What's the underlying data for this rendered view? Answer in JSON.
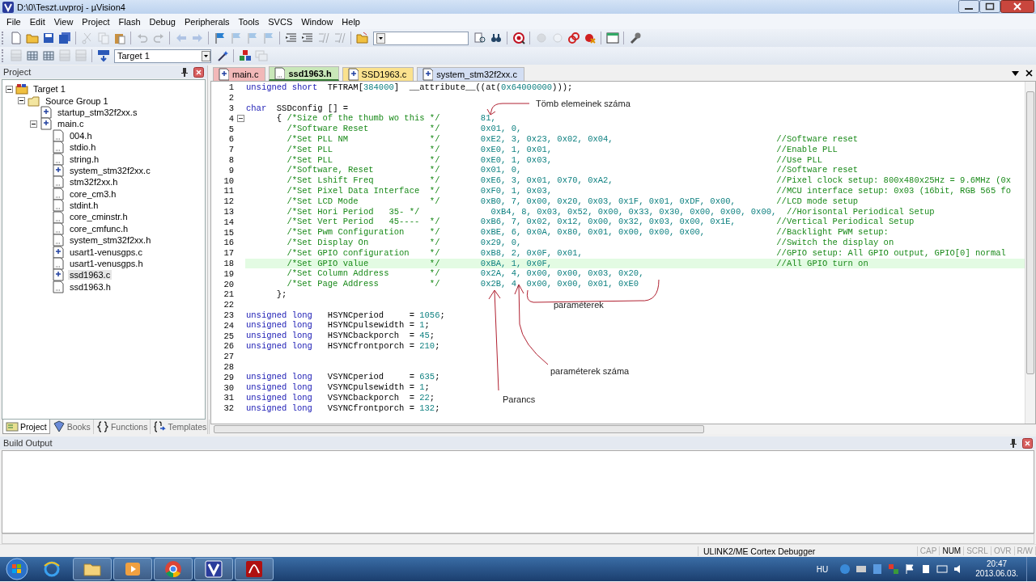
{
  "window": {
    "title": "D:\\0\\Teszt.uvproj - µVision4"
  },
  "menu": [
    "File",
    "Edit",
    "View",
    "Project",
    "Flash",
    "Debug",
    "Peripherals",
    "Tools",
    "SVCS",
    "Window",
    "Help"
  ],
  "toolbar_1": [
    {
      "disabled": false
    },
    {
      "disabled": false
    },
    {
      "disabled": false
    },
    {
      "disabled": false
    },
    {
      "disabled": true
    },
    {
      "disabled": true
    },
    {
      "disabled": false
    },
    {
      "disabled": true
    },
    {
      "disabled": true
    },
    {
      "disabled": true
    },
    {
      "disabled": true
    },
    {
      "disabled": false
    },
    {
      "disabled": true
    },
    {
      "disabled": true
    },
    {
      "disabled": true
    },
    {
      "disabled": false
    },
    {
      "disabled": false
    },
    {
      "disabled": true
    },
    {
      "disabled": true
    },
    {
      "disabled": false
    },
    {
      "disabled": false
    },
    {
      "disabled": false
    },
    {
      "disabled": false
    },
    {
      "disabled": true
    },
    {
      "disabled": true
    },
    {
      "disabled": false
    },
    {
      "disabled": false
    },
    {
      "disabled": false
    },
    {
      "disabled": false
    }
  ],
  "toolbar_2": {
    "buttons": [
      {
        "disabled": true
      },
      {
        "disabled": false
      },
      {
        "disabled": false
      },
      {
        "disabled": true
      },
      {
        "disabled": true
      },
      {
        "disabled": false
      }
    ],
    "target": "Target 1",
    "tools": [
      {
        "disabled": false
      },
      {
        "disabled": false
      },
      {
        "disabled": true
      }
    ]
  },
  "project_panel": {
    "title": "Project",
    "tree": [
      {
        "label": "Target 1",
        "kind": "target",
        "expanded": true,
        "selected": false,
        "children": [
          {
            "label": "Source Group 1",
            "kind": "group",
            "expanded": true,
            "selected": false,
            "children": [
              {
                "label": "startup_stm32f2xx.s",
                "kind": "source",
                "selected": false
              },
              {
                "label": "main.c",
                "kind": "source",
                "expanded": true,
                "selected": false,
                "children": [
                  {
                    "label": "004.h",
                    "kind": "header",
                    "selected": false
                  },
                  {
                    "label": "stdio.h",
                    "kind": "header",
                    "selected": false
                  },
                  {
                    "label": "string.h",
                    "kind": "header",
                    "selected": false
                  },
                  {
                    "label": "system_stm32f2xx.c",
                    "kind": "source",
                    "selected": false
                  },
                  {
                    "label": "stm32f2xx.h",
                    "kind": "header",
                    "selected": false
                  },
                  {
                    "label": "core_cm3.h",
                    "kind": "header",
                    "selected": false
                  },
                  {
                    "label": "stdint.h",
                    "kind": "header",
                    "selected": false
                  },
                  {
                    "label": "core_cminstr.h",
                    "kind": "header",
                    "selected": false
                  },
                  {
                    "label": "core_cmfunc.h",
                    "kind": "header",
                    "selected": false
                  },
                  {
                    "label": "system_stm32f2xx.h",
                    "kind": "header",
                    "selected": false
                  },
                  {
                    "label": "usart1-venusgps.c",
                    "kind": "source",
                    "selected": false
                  },
                  {
                    "label": "usart1-venusgps.h",
                    "kind": "header",
                    "selected": false
                  },
                  {
                    "label": "ssd1963.c",
                    "kind": "source",
                    "selected": true
                  },
                  {
                    "label": "ssd1963.h",
                    "kind": "header",
                    "selected": false
                  }
                ]
              }
            ]
          }
        ]
      }
    ],
    "tabs": [
      {
        "label": "Project",
        "selected": true
      },
      {
        "label": "Books",
        "selected": false
      },
      {
        "label": "Functions",
        "selected": false
      },
      {
        "label": "Templates",
        "selected": false
      }
    ]
  },
  "editor": {
    "tabs": [
      {
        "label": "main.c",
        "kind": "source",
        "color": "#f2b8b8",
        "selected": false
      },
      {
        "label": "ssd1963.h",
        "kind": "header",
        "color": "#c9e7b9",
        "selected": true
      },
      {
        "label": "SSD1963.c",
        "kind": "source",
        "color": "#fbe28e",
        "selected": false
      },
      {
        "label": "system_stm32f2xx.c",
        "kind": "source",
        "color": "#d3def3",
        "selected": false
      }
    ],
    "lines": [
      {
        "number": "1",
        "highlighted": false,
        "kind": "code",
        "segments": [
          {
            "kind": "keyword",
            "text": "unsigned short"
          },
          {
            "kind": "plain",
            "text": "  TFTRAM["
          },
          {
            "kind": "number",
            "text": "384000"
          },
          {
            "kind": "plain",
            "text": "]  __attribute__((at("
          },
          {
            "kind": "number",
            "text": "0x64000000"
          },
          {
            "kind": "plain",
            "text": ")));"
          }
        ]
      },
      {
        "number": "2",
        "highlighted": false,
        "kind": "code"
      },
      {
        "number": "3",
        "highlighted": false,
        "kind": "code",
        "segments": [
          {
            "kind": "keyword",
            "text": "char"
          },
          {
            "kind": "plain",
            "text": "  SSDconfig [] ="
          }
        ]
      },
      {
        "number": "4",
        "highlighted": false,
        "kind": "entry",
        "fold": {
          "expanded": true
        },
        "open": "{",
        "comment": "/*Size of the thumb wo this",
        "comment_end": "*/",
        "values": "81,"
      },
      {
        "number": "5",
        "highlighted": false,
        "kind": "entry",
        "comment": "/*Software Reset",
        "comment_end": "*/",
        "values": "0x01, 0,"
      },
      {
        "number": "6",
        "highlighted": false,
        "kind": "entry",
        "comment": "/*Set PLL NM",
        "comment_end": "*/",
        "values": "0xE2, 3, 0x23, 0x02, 0x04,",
        "note": "//Software reset"
      },
      {
        "number": "7",
        "highlighted": false,
        "kind": "entry",
        "comment": "/*Set PLL",
        "comment_end": "*/",
        "values": "0xE0, 1, 0x01,",
        "note": "//Enable PLL"
      },
      {
        "number": "8",
        "highlighted": false,
        "kind": "entry",
        "comment": "/*Set PLL",
        "comment_end": "*/",
        "values": "0xE0, 1, 0x03,",
        "note": "//Use PLL"
      },
      {
        "number": "9",
        "highlighted": false,
        "kind": "entry",
        "comment": "/*Software, Reset",
        "comment_end": "*/",
        "values": "0x01, 0,",
        "note": "//Software reset"
      },
      {
        "number": "10",
        "highlighted": false,
        "kind": "entry",
        "comment": "/*Set Lshift Freq",
        "comment_end": "*/",
        "values": "0xE6, 3, 0x01, 0x70, 0xA2,",
        "note": "//Pixel clock setup: 800x480x25Hz = 9.6MHz (0x"
      },
      {
        "number": "11",
        "highlighted": false,
        "kind": "entry",
        "comment": "/*Set Pixel Data Interface",
        "comment_end": "*/",
        "values": "0xF0, 1, 0x03,",
        "note": "//MCU interface setup: 0x03 (16bit, RGB 565 fo"
      },
      {
        "number": "12",
        "highlighted": false,
        "kind": "entry",
        "comment": "/*Set LCD Mode",
        "comment_end": "*/",
        "values": "0xB0, 7, 0x00, 0x20, 0x03, 0x1F, 0x01, 0xDF, 0x00,",
        "note": "//LCD mode setup"
      },
      {
        "number": "13",
        "highlighted": false,
        "kind": "entry",
        "comment": "/*Set Hori Period   35- */",
        "values": "0xB4, 8, 0x03, 0x52, 0x00, 0x33, 0x30, 0x00, 0x00, 0x00,",
        "note": "//Horisontal Periodical Setup"
      },
      {
        "number": "14",
        "highlighted": false,
        "kind": "entry",
        "comment": "/*Set Vert Period   45----",
        "comment_end": "*/",
        "values": "0xB6, 7, 0x02, 0x12, 0x00, 0x32, 0x03, 0x00, 0x1E,",
        "note": "//Vertical Periodical Setup"
      },
      {
        "number": "15",
        "highlighted": false,
        "kind": "entry",
        "comment": "/*Set Pwm Configuration",
        "comment_end": "*/",
        "values": "0xBE, 6, 0x0A, 0x80, 0x01, 0x00, 0x00, 0x00,",
        "note": "//Backlight PWM setup:"
      },
      {
        "number": "16",
        "highlighted": false,
        "kind": "entry",
        "comment": "/*Set Display On",
        "comment_end": "*/",
        "values": "0x29, 0,",
        "note": "//Switch the display on"
      },
      {
        "number": "17",
        "highlighted": false,
        "kind": "entry",
        "comment": "/*Set GPIO configuration",
        "comment_end": "*/",
        "values": "0xB8, 2, 0x0F, 0x01,",
        "note": "//GPIO setup: All GPIO output, GPIO[0] normal"
      },
      {
        "number": "18",
        "highlighted": true,
        "kind": "entry",
        "comment": "/*Set GPIO value",
        "comment_end": "*/",
        "values": "0xBA, 1, 0x0F,",
        "note": "//All GPIO turn on"
      },
      {
        "number": "19",
        "highlighted": false,
        "kind": "entry",
        "comment": "/*Set Column Address",
        "comment_end": "*/",
        "values": "0x2A, 4, 0x00, 0x00, 0x03, 0x20,"
      },
      {
        "number": "20",
        "highlighted": false,
        "kind": "entry",
        "comment": "/*Set Page Address",
        "comment_end": "*/",
        "values": "0x2B, 4, 0x00, 0x00, 0x01, 0xE0"
      },
      {
        "number": "21",
        "highlighted": false,
        "kind": "entry",
        "open": "};"
      },
      {
        "number": "22",
        "highlighted": false,
        "kind": "code"
      },
      {
        "number": "23",
        "highlighted": false,
        "kind": "code",
        "segments": [
          {
            "kind": "keyword",
            "text": "unsigned long"
          },
          {
            "kind": "plain",
            "text": "   HSYNCperiod     = "
          },
          {
            "kind": "number",
            "text": "1056"
          },
          {
            "kind": "plain",
            "text": ";"
          }
        ]
      },
      {
        "number": "24",
        "highlighted": false,
        "kind": "code",
        "segments": [
          {
            "kind": "keyword",
            "text": "unsigned long"
          },
          {
            "kind": "plain",
            "text": "   HSYNCpulsewidth = "
          },
          {
            "kind": "number",
            "text": "1"
          },
          {
            "kind": "plain",
            "text": ";"
          }
        ]
      },
      {
        "number": "25",
        "highlighted": false,
        "kind": "code",
        "segments": [
          {
            "kind": "keyword",
            "text": "unsigned long"
          },
          {
            "kind": "plain",
            "text": "   HSYNCbackporch  = "
          },
          {
            "kind": "number",
            "text": "45"
          },
          {
            "kind": "plain",
            "text": ";"
          }
        ]
      },
      {
        "number": "26",
        "highlighted": false,
        "kind": "code",
        "segments": [
          {
            "kind": "keyword",
            "text": "unsigned long"
          },
          {
            "kind": "plain",
            "text": "   HSYNCfrontporch = "
          },
          {
            "kind": "number",
            "text": "210"
          },
          {
            "kind": "plain",
            "text": ";"
          }
        ]
      },
      {
        "number": "27",
        "highlighted": false,
        "kind": "code"
      },
      {
        "number": "28",
        "highlighted": false,
        "kind": "code"
      },
      {
        "number": "29",
        "highlighted": false,
        "kind": "code",
        "segments": [
          {
            "kind": "keyword",
            "text": "unsigned long"
          },
          {
            "kind": "plain",
            "text": "   VSYNCperiod     = "
          },
          {
            "kind": "number",
            "text": "635"
          },
          {
            "kind": "plain",
            "text": ";"
          }
        ]
      },
      {
        "number": "30",
        "highlighted": false,
        "kind": "code",
        "segments": [
          {
            "kind": "keyword",
            "text": "unsigned long"
          },
          {
            "kind": "plain",
            "text": "   VSYNCpulsewidth = "
          },
          {
            "kind": "number",
            "text": "1"
          },
          {
            "kind": "plain",
            "text": ";"
          }
        ]
      },
      {
        "number": "31",
        "highlighted": false,
        "kind": "code",
        "segments": [
          {
            "kind": "keyword",
            "text": "unsigned long"
          },
          {
            "kind": "plain",
            "text": "   VSYNCbackporch  = "
          },
          {
            "kind": "number",
            "text": "22"
          },
          {
            "kind": "plain",
            "text": ";"
          }
        ]
      },
      {
        "number": "32",
        "highlighted": false,
        "kind": "code",
        "segments": [
          {
            "kind": "keyword",
            "text": "unsigned long"
          },
          {
            "kind": "plain",
            "text": "   VSYNCfrontporch = "
          },
          {
            "kind": "number",
            "text": "132"
          },
          {
            "kind": "plain",
            "text": ";"
          }
        ]
      }
    ],
    "annotations": [
      {
        "text": "Tömb elemeinek száma"
      },
      {
        "text": "paraméterek"
      },
      {
        "text": "paraméterek száma"
      },
      {
        "text": "Parancs"
      }
    ]
  },
  "build_output": {
    "title": "Build Output"
  },
  "status_bar": {
    "debugger": "ULINK2/ME Cortex Debugger",
    "indicators": [
      {
        "label": "CAP",
        "on": false
      },
      {
        "label": "NUM",
        "on": true
      },
      {
        "label": "SCRL",
        "on": false
      },
      {
        "label": "OVR",
        "on": false
      },
      {
        "label": "R/W",
        "on": false
      }
    ]
  },
  "taskbar": {
    "apps": [
      {
        "running": false
      },
      {
        "running": true
      },
      {
        "running": true
      },
      {
        "running": true
      },
      {
        "running": true
      },
      {
        "running": true
      }
    ],
    "language": "HU",
    "time": "20:47",
    "date": "2013.06.03."
  }
}
